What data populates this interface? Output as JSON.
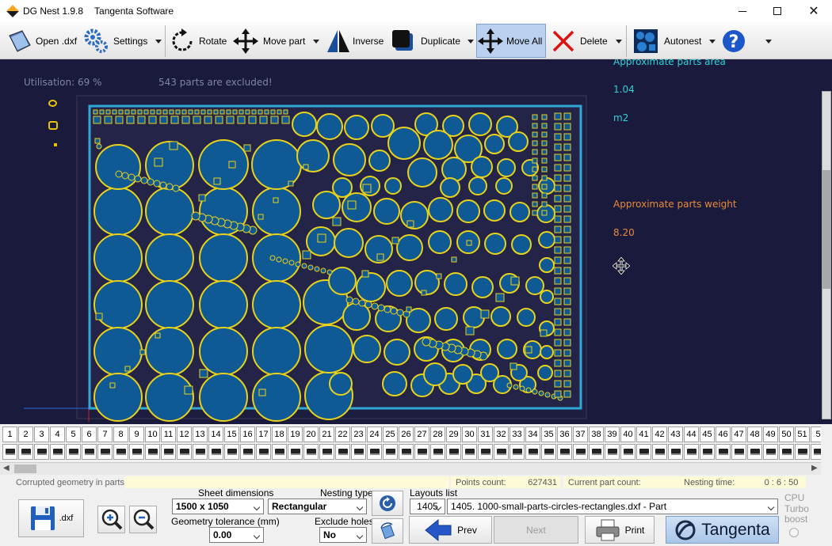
{
  "titlebar": {
    "app_title": "DG Nest 1.9.8",
    "company": "Tangenta Software"
  },
  "toolbar": {
    "open_label": "Open .dxf",
    "settings_label": "Settings",
    "rotate_label": "Rotate",
    "move_part_label": "Move part",
    "inverse_label": "Inverse",
    "duplicate_label": "Duplicate",
    "move_all_label": "Move All",
    "delete_label": "Delete",
    "autonest_label": "Autonest"
  },
  "workspace": {
    "utilisation": "Utilisation: 69 %",
    "excluded": "543 parts are excluded!",
    "parts_area_label": "Approximate parts area",
    "parts_area_value": "1.04",
    "parts_area_unit": "m2",
    "parts_weight_label": "Approximate parts weight",
    "parts_weight_value": "8.20",
    "colors": {
      "background": "#1a1a3c",
      "part_fill": "#0f5a94",
      "part_outline": "#e8d21c",
      "sheet_border": "#2fa8d8",
      "area_text": "#2fd3d8",
      "weight_text": "#e88a3a"
    }
  },
  "tabs": {
    "numbers": [
      "1",
      "2",
      "3",
      "4",
      "5",
      "6",
      "7",
      "8",
      "9",
      "10",
      "11",
      "12",
      "13",
      "14",
      "15",
      "16",
      "17",
      "18",
      "19",
      "20",
      "21",
      "22",
      "23",
      "24",
      "25",
      "26",
      "27",
      "28",
      "29",
      "30",
      "31",
      "32",
      "33",
      "34",
      "35",
      "36",
      "37",
      "38",
      "39",
      "40",
      "41",
      "42",
      "43",
      "44",
      "45",
      "46",
      "47",
      "48",
      "49",
      "50",
      "51",
      "5"
    ]
  },
  "status": {
    "corrupted_label": "Corrupted geometry in parts:",
    "points_label": "Points count:",
    "points_value": "627431",
    "current_part_label": "Current part count:",
    "nesting_time_label": "Nesting time:",
    "nesting_time_value": "0 : 6 : 50"
  },
  "controls": {
    "save_label": ".dxf",
    "sheet_dimensions_label": "Sheet dimensions",
    "sheet_dimensions_value": "1500 x 1050",
    "nesting_type_label": "Nesting type",
    "nesting_type_value": "Rectangular",
    "geometry_tolerance_label": "Geometry tolerance (mm)",
    "geometry_tolerance_value": "0.00",
    "exclude_holes_label": "Exclude holes",
    "exclude_holes_value": "No",
    "layouts_list_label": "Layouts list",
    "layout_index": "1405",
    "layout_name": "1405. 1000-small-parts-circles-rectangles.dxf - Part",
    "prev_label": "Prev",
    "next_label": "Next",
    "print_label": "Print",
    "brand_label": "Tangenta",
    "cpu_label_1": "CPU",
    "cpu_label_2": "Turbo",
    "cpu_label_3": "boost"
  }
}
